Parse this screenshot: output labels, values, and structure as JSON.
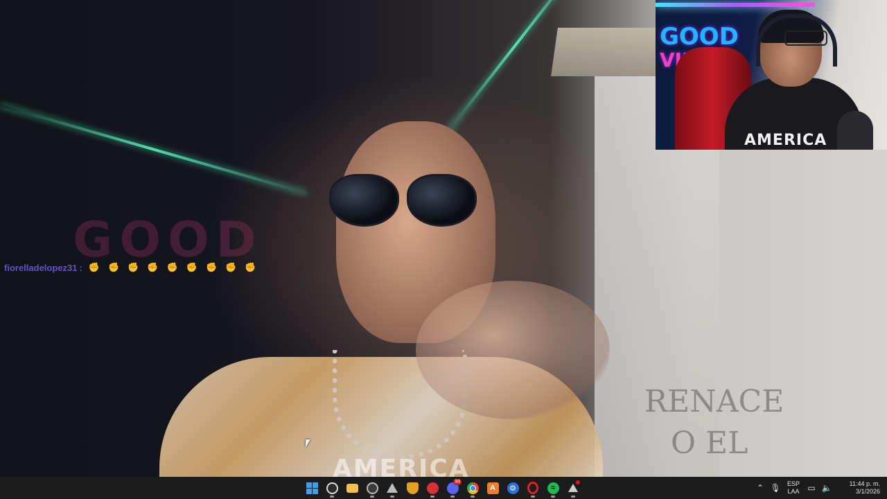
{
  "video": {
    "chat_username": "fiorelladelopez31",
    "chat_separator": ":",
    "chat_emojis": "✊✊✊✊✊✊✊✊✊",
    "wall_text_line1": "RENACE",
    "wall_text_line2": "O EL",
    "shirt_text": "AMERICA",
    "watermark_text": "GOOD"
  },
  "webcam": {
    "logo_line1": "GOOD",
    "logo_line2": "VIBES",
    "shirt_text": "AMERICA"
  },
  "taskbar": {
    "apps": [
      {
        "name": "start-button",
        "icon": "windows-icon",
        "color": "#3aa0f3"
      },
      {
        "name": "obs-button",
        "icon": "obs-icon",
        "color": "#2b2b2b"
      },
      {
        "name": "file-explorer-button",
        "icon": "folder-icon",
        "color": "#f2c14e"
      },
      {
        "name": "app-button-1",
        "icon": "aperture-icon",
        "color": "#3a3a3a"
      },
      {
        "name": "app-button-2",
        "icon": "triangle-icon",
        "color": "#444444"
      },
      {
        "name": "app-button-3",
        "icon": "shield-icon",
        "color": "#e0a020"
      },
      {
        "name": "app-button-4",
        "icon": "target-icon",
        "color": "#d6303a"
      },
      {
        "name": "discord-button",
        "icon": "discord-icon",
        "color": "#5865f2",
        "badge": "99"
      },
      {
        "name": "chrome-button",
        "icon": "chrome-icon",
        "color": "#34a853"
      },
      {
        "name": "app-button-5",
        "icon": "a-logo-icon",
        "color": "#f07d2c"
      },
      {
        "name": "app-button-6",
        "icon": "gear-icon",
        "color": "#2f6fd6"
      },
      {
        "name": "opera-button",
        "icon": "opera-icon",
        "color": "#e0202c"
      },
      {
        "name": "spotify-button",
        "icon": "spotify-icon",
        "color": "#1db954"
      },
      {
        "name": "app-button-7",
        "icon": "up-arrow-icon",
        "color": "#333333"
      }
    ],
    "language_line1": "ESP",
    "language_line2": "LAA",
    "time": "11:44 p. m.",
    "date": "3/1/2026"
  }
}
